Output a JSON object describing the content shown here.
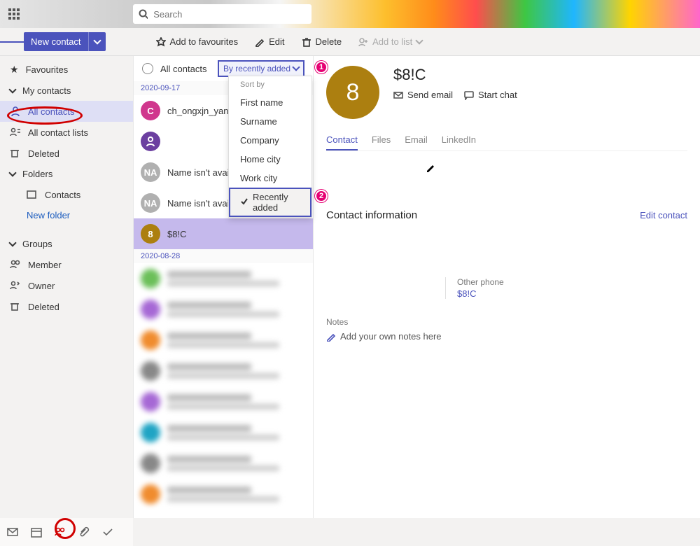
{
  "colors": {
    "accent": "#4b53bc",
    "avatar_gold": "#ac7f10",
    "annotation": "#e60073"
  },
  "topbar": {
    "search_placeholder": "Search"
  },
  "toolbar": {
    "new_contact": "New contact",
    "fav": "Add to favourites",
    "edit": "Edit",
    "delete": "Delete",
    "add_to_list": "Add to list"
  },
  "sidebar": {
    "favourites": "Favourites",
    "my_contacts": "My contacts",
    "all_contacts": "All contacts",
    "all_lists": "All contact lists",
    "deleted": "Deleted",
    "folders": "Folders",
    "contacts_folder": "Contacts",
    "new_folder": "New folder",
    "groups": "Groups",
    "member": "Member",
    "owner": "Owner",
    "g_deleted": "Deleted"
  },
  "listpane": {
    "head_label": "All contacts",
    "sort_label": "By recently added",
    "date1": "2020-09-17",
    "date2": "2020-08-28",
    "rows": [
      {
        "initial": "C",
        "bg": "#d0378d",
        "text": "ch_ongxjn_yang@dad"
      },
      {
        "initial": "",
        "bg": "#6b3fa0",
        "svg": true,
        "text": ""
      },
      {
        "initial": "NA",
        "bg": "#b0b0b0",
        "text": "Name isn't available."
      },
      {
        "initial": "NA",
        "bg": "#b0b0b0",
        "text": "Name isn't available."
      },
      {
        "initial": "8",
        "bg": "#ac7f10",
        "text": "$8!C",
        "selected": true
      }
    ]
  },
  "dropdown": {
    "header": "Sort by",
    "items": [
      "First name",
      "Surname",
      "Company",
      "Home city",
      "Work city",
      "Recently added"
    ],
    "selected_index": 5
  },
  "annotations": {
    "one": "1",
    "two": "2"
  },
  "detail": {
    "avatar_letter": "8",
    "title": "$8!C",
    "send_email": "Send email",
    "start_chat": "Start chat",
    "tabs": [
      "Contact",
      "Files",
      "Email",
      "LinkedIn"
    ],
    "section_title": "Contact information",
    "edit_contact": "Edit contact",
    "other_phone_label": "Other phone",
    "other_phone_value": "$8!C",
    "notes_hdr": "Notes",
    "notes_add": "Add your own notes here"
  }
}
